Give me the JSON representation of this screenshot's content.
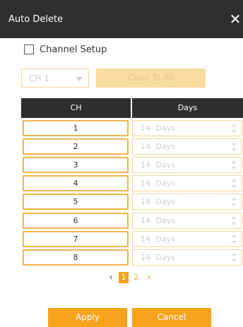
{
  "window": {
    "title": "Auto Delete",
    "close_glyph": "✕"
  },
  "channel_setup": {
    "label": "Channel Setup",
    "checked": false
  },
  "controls": {
    "channel_select_value": "CH 1",
    "copy_button_label": "Copy To All"
  },
  "table": {
    "headers": [
      "CH",
      "Days"
    ],
    "rows": [
      {
        "ch": "1",
        "days": "14  Days"
      },
      {
        "ch": "2",
        "days": "14  Days"
      },
      {
        "ch": "3",
        "days": "14  Days"
      },
      {
        "ch": "4",
        "days": "14  Days"
      },
      {
        "ch": "5",
        "days": "14  Days"
      },
      {
        "ch": "6",
        "days": "14  Days"
      },
      {
        "ch": "7",
        "days": "14  Days"
      },
      {
        "ch": "8",
        "days": "14  Days"
      }
    ]
  },
  "pagination": {
    "prev_glyph": "‹",
    "next_glyph": "›",
    "pages": [
      "1",
      "2"
    ],
    "current_page": "1"
  },
  "footer": {
    "apply_label": "Apply",
    "cancel_label": "Cancel"
  },
  "colors": {
    "accent": "#f7a21c",
    "titlebar": "#2f2f2f",
    "header": "#2e2e2e"
  },
  "icons": {
    "close": "close-icon",
    "dropdown": "chevron-down-icon",
    "spin_up": "spin-up-icon",
    "spin_down": "spin-down-icon",
    "prev": "chevron-left-icon",
    "next": "chevron-right-icon"
  }
}
